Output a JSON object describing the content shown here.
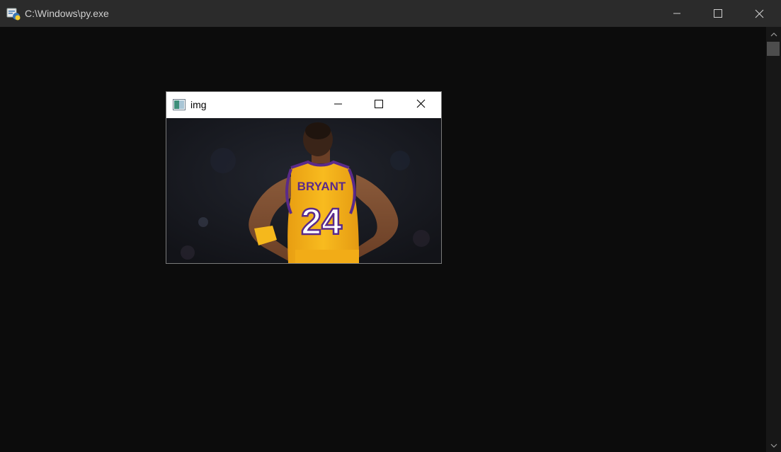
{
  "console": {
    "title": "C:\\Windows\\py.exe"
  },
  "image_window": {
    "title": "img",
    "jersey_name": "BRYANT",
    "jersey_number": "24"
  },
  "colors": {
    "console_bg": "#0c0c0c",
    "titlebar_bg": "#2b2b2b",
    "jersey_gold": "#f6b21a",
    "jersey_purple": "#5a2a8a"
  }
}
